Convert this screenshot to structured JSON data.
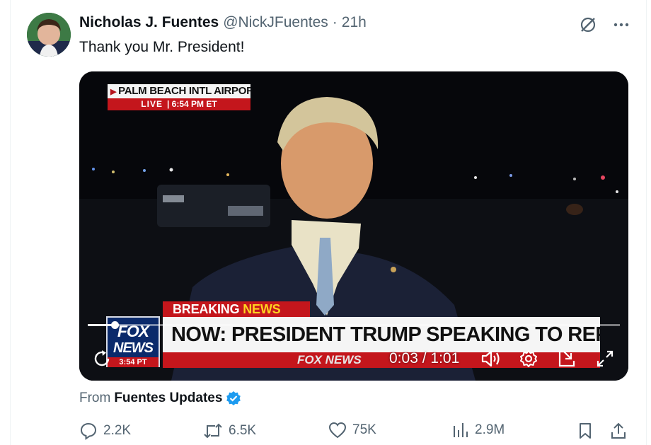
{
  "tweet": {
    "display_name": "Nicholas J. Fuentes",
    "handle": "@NickJFuentes",
    "separator": "·",
    "time": "21h",
    "text": "Thank you Mr. President!"
  },
  "video": {
    "location_label": "PALM BEACH INTL AIRPORT",
    "live_label": "LIVE",
    "live_divider": "|",
    "live_time": "6:54 PM ET",
    "breaking_label": "BREAKING",
    "breaking_news_label": "NEWS",
    "headline": "NOW: PRESIDENT TRUMP SPEAKING TO REPORTERS",
    "ticker_logo": "FOX NEWS",
    "fox_logo_line1": "FOX",
    "fox_logo_line2": "NEWS",
    "fox_logo_time": "3:54 PT",
    "current_time": "0:03",
    "time_separator": "/",
    "duration": "1:01",
    "progress": 0.05
  },
  "source": {
    "prefix": "From",
    "name": "Fuentes Updates"
  },
  "stats": {
    "replies": "2.2K",
    "reposts": "6.5K",
    "likes": "75K",
    "views": "2.9M"
  },
  "colors": {
    "accent": "#1d9bf0",
    "muted": "#536471",
    "fox_red": "#c4161c",
    "fox_blue": "#0b2a6b"
  },
  "icons": [
    "grok-icon",
    "more-icon",
    "replay-icon",
    "volume-icon",
    "settings-icon",
    "minimize-icon",
    "fullscreen-icon",
    "verified-badge-icon",
    "reply-icon",
    "repost-icon",
    "like-icon",
    "views-icon",
    "bookmark-icon",
    "share-icon"
  ]
}
